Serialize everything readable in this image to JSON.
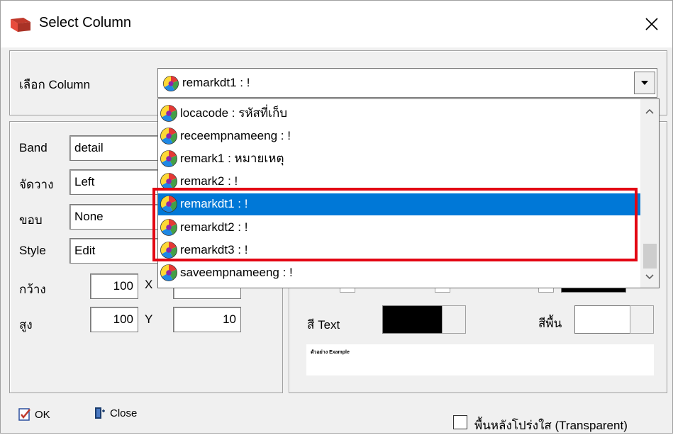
{
  "window": {
    "title": "Select Column",
    "close_label": "×"
  },
  "column_select": {
    "label": "เลือก Column",
    "selected": "remarkdt1 : !"
  },
  "dropdown": {
    "items": [
      {
        "text": "locacode : รหัสที่เก็บ",
        "selected": false
      },
      {
        "text": "receempnameeng : !",
        "selected": false
      },
      {
        "text": "remark1 : หมายเหตุ",
        "selected": false
      },
      {
        "text": "remark2 : !",
        "selected": false
      },
      {
        "text": "remarkdt1 : !",
        "selected": true
      },
      {
        "text": "remarkdt2 : !",
        "selected": false
      },
      {
        "text": "remarkdt3 : !",
        "selected": false
      },
      {
        "text": "saveempnameeng : !",
        "selected": false
      }
    ]
  },
  "properties": {
    "band": {
      "label": "Band",
      "value": "detail"
    },
    "align": {
      "label": "จัดวาง",
      "value": "Left"
    },
    "border": {
      "label": "ขอบ",
      "value": "None"
    },
    "style": {
      "label": "Style",
      "value": "Edit"
    },
    "width": {
      "label": "กว้าง",
      "value": "100",
      "x_label": "X"
    },
    "height": {
      "label": "สูง",
      "value": "100",
      "y_label": "Y",
      "y_value": "10"
    }
  },
  "colors": {
    "text_label": "สี Text",
    "text_color": "#000000",
    "bg_label": "สีพื้น",
    "bg_color": "#ffffff"
  },
  "sample": {
    "text": "ตัวอย่าง Example"
  },
  "footer": {
    "ok_label": "OK",
    "close_label": "Close",
    "transparent_label": "พื้นหลังโปร่งใส (Transparent)"
  },
  "theme": {
    "selection": "#0078d7",
    "highlight_border": "#e30613"
  }
}
